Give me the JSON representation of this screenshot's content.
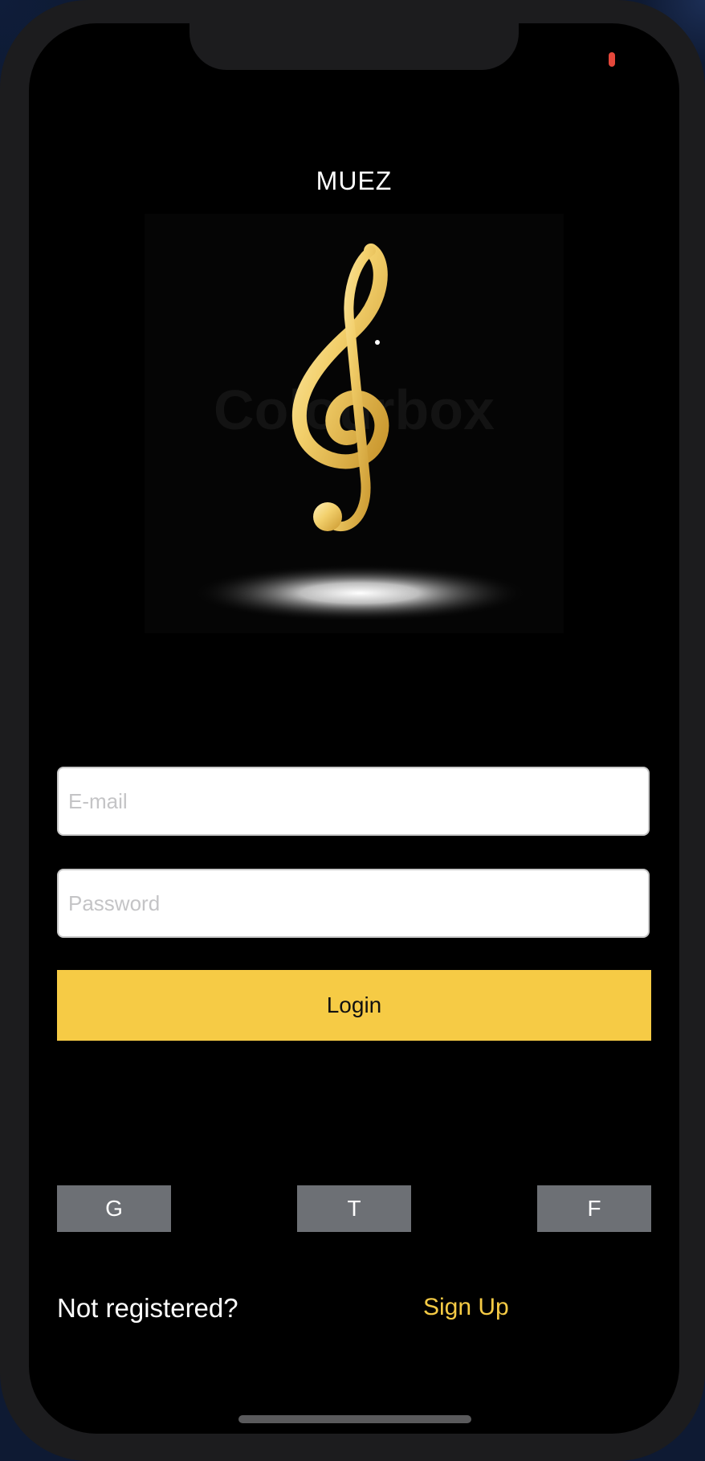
{
  "app": {
    "title": "MUEZ"
  },
  "hero": {
    "watermark": "Colourbox",
    "icon": "treble-clef-icon"
  },
  "form": {
    "email_placeholder": "E-mail",
    "email_value": "",
    "password_placeholder": "Password",
    "password_value": "",
    "login_label": "Login"
  },
  "social": {
    "google_label": "G",
    "twitter_label": "T",
    "facebook_label": "F"
  },
  "footer": {
    "prompt": "Not registered?",
    "signup_label": "Sign Up"
  },
  "colors": {
    "accent": "#f6cb45",
    "background": "#000000",
    "social_button": "#6d7075",
    "status_indicator": "#e5483b"
  }
}
